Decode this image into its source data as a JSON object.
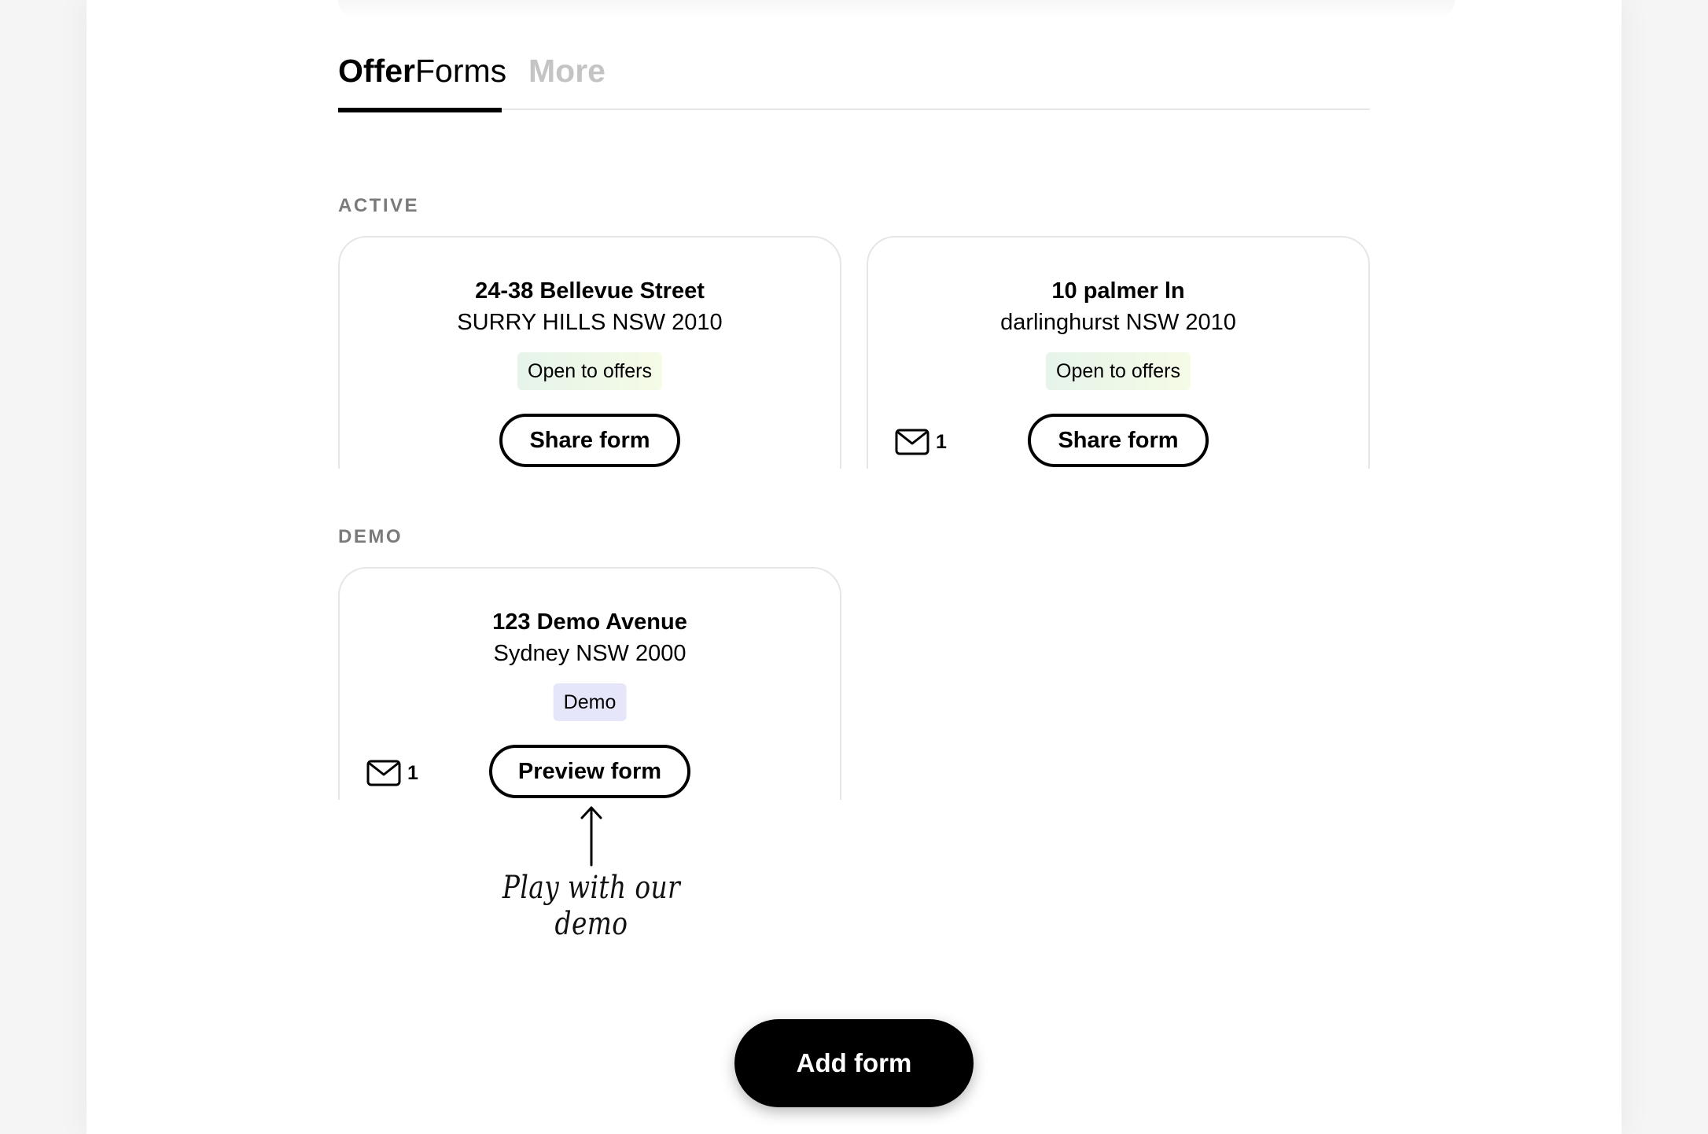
{
  "tabs": {
    "offerforms_bold": "Offer",
    "offerforms_regular": "Forms",
    "more": "More"
  },
  "sections": {
    "active_label": "ACTIVE",
    "demo_label": "DEMO"
  },
  "active_cards": [
    {
      "address": "24-38 Bellevue Street",
      "suburb": "SURRY HILLS NSW 2010",
      "status": "Open to offers",
      "button": "Share form"
    },
    {
      "address": "10 palmer ln",
      "suburb": "darlinghurst NSW 2010",
      "status": "Open to offers",
      "button": "Share form",
      "message_count": "1"
    }
  ],
  "demo_card": {
    "address": "123 Demo Avenue",
    "suburb": "Sydney NSW 2000",
    "status": "Demo",
    "button": "Preview form",
    "message_count": "1"
  },
  "hint": {
    "text": "Play with our demo"
  },
  "add_form_button": "Add form",
  "icons": {
    "message": "envelope-icon",
    "hint_arrow": "arrow-up-icon"
  },
  "colors": {
    "open_badge_bg": "#e6f4ea",
    "demo_badge_bg": "#e6e6fa",
    "section_label": "#7a7a7a",
    "tab_inactive": "#c4c4c4"
  }
}
